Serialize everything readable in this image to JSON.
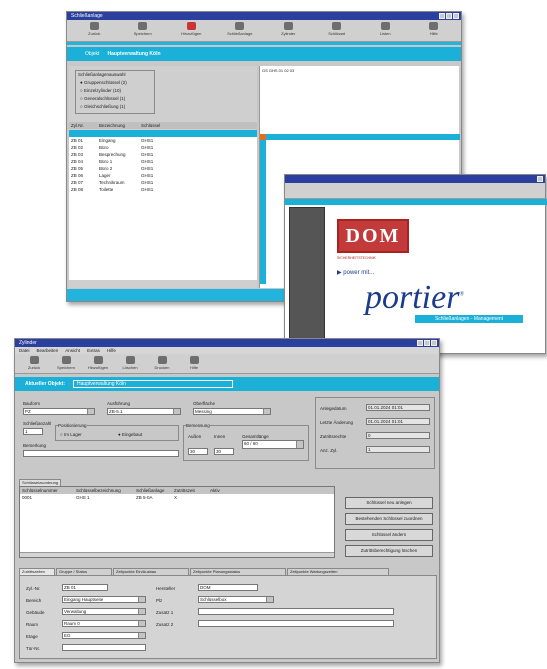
{
  "top_window": {
    "title": "Schließanlage",
    "toolbar": [
      "Zurück",
      "Speichern",
      "Hinzufügen",
      "Schließanlage",
      "Zylinder",
      "Schlüssel",
      "Listen",
      "Hilfe"
    ],
    "header_left": "Objekt",
    "header_right": "Hauptverwaltung Köln",
    "filter_title": "Schließanlagenauswahl",
    "filters": [
      "Gruppenschlüssel (2)",
      "Einzelzylinder (10)",
      "Generalschlüssel (1)",
      "Gleichschließung (1)"
    ],
    "columns": [
      "Zyl.Nr.",
      "Bezeichnung",
      "Schlüssel"
    ],
    "rows": [
      [
        "ZB 01",
        "Eingang",
        "GHS1"
      ],
      [
        "ZB 02",
        "Büro",
        "GHS1"
      ],
      [
        "ZB 03",
        "Besprechung",
        "GHS1"
      ],
      [
        "ZB 04",
        "Büro 1",
        "GHS1"
      ],
      [
        "ZB 05",
        "Büro 2",
        "GHS1"
      ],
      [
        "ZB 06",
        "Lager",
        "GHS1"
      ],
      [
        "ZB 07",
        "Technikraum",
        "GHS1"
      ],
      [
        "ZB 08",
        "Toilette",
        "GHS1"
      ]
    ],
    "matrix_header": "GS GHS 01 02 03"
  },
  "splash": {
    "brand": "DOM",
    "tagline": "SICHERHEITSTECHNIK",
    "sub": "power mit...",
    "product": "portier",
    "reg": "®",
    "badge": "Schließanlagen - Management"
  },
  "bottom_window": {
    "title": "Zylinder",
    "menu": [
      "Datei",
      "Bearbeiten",
      "Ansicht",
      "Extras",
      "Hilfe"
    ],
    "toolbar": [
      "Zurück",
      "Speichern",
      "Hinzufügen",
      "Löschen",
      "Drucken",
      "Hilfe"
    ],
    "header_label": "Aktueller Objekt:",
    "header_value": "Hauptverwaltung Köln",
    "form": {
      "bauform_label": "Bauform",
      "bauform_value": "PZ",
      "ausfuehrung_label": "Ausführung",
      "ausfuehrung_value": "ZB-5.1",
      "oberflaeche_label": "Oberfläche",
      "oberflaeche_value": "Messing",
      "schliessanzahl_label": "Schließanzahl",
      "schliessanzahl_value": "1",
      "position_label": "Positionierung",
      "radio1": "Im Lager",
      "radio2": "Eingebaut",
      "bemerkung_label": "Bemerkung",
      "bemessung_label": "Bemessung",
      "aussen_label": "Außen",
      "innen_label": "Innen",
      "gesamt_label": "Gesamtlänge",
      "aussen_value": "30",
      "innen_value": "30",
      "gesamt_value": "60 / 60",
      "r_label1": "Anlegedatum",
      "r_value1": "01.01.2024 01:01",
      "r_label2": "Letzte Änderung",
      "r_value2": "01.01.2024 01:01",
      "r_label3": "Zutrittsrechte",
      "r_value3": "0",
      "r_label4": "Anz. Zyl.",
      "r_value4": "1"
    },
    "list_tab": "Schlüsselzuordnung",
    "list_columns": [
      "Schlüsselnummer",
      "Schlüsselbezeichnung",
      "Schließanlage",
      "Zutrittszeit",
      "Aktiv"
    ],
    "list_row": [
      "0001",
      "GHS 1",
      "ZB 5-0A",
      "X",
      ""
    ],
    "side_buttons": [
      "Schlüssel neu anlegen",
      "Bestehenden Schlüssel zuordnen",
      "Schlüssel ändern",
      "Zutrittsberechtigung löschen"
    ],
    "bottom_tabs": [
      "Zutrittszeiten",
      "Gruppe / Status",
      "Zeitpunkte Ein/Ausbau",
      "Zeitpunkte Planungsstatus",
      "Zeitpunkte Wartungszeiten"
    ],
    "detail": {
      "l1": "Zyl.-Nr.",
      "v1": "ZB 01",
      "l2": "Bereich",
      "v2": "Eingang Hauptseite",
      "l3": "Gebäude",
      "v3": "Verwaltung",
      "l4": "Raum",
      "v4": "Raum 0",
      "l5": "Etage",
      "v5": "EG",
      "l6": "Tür-Nr.",
      "v6": "",
      "r1": "Hersteller",
      "rv1": "DOM",
      "r2": "Plz",
      "rv2": "Schlüsselbox",
      "r3": "Zusatz 1",
      "rv3": "",
      "r4": "Zusatz 2",
      "rv4": ""
    }
  }
}
